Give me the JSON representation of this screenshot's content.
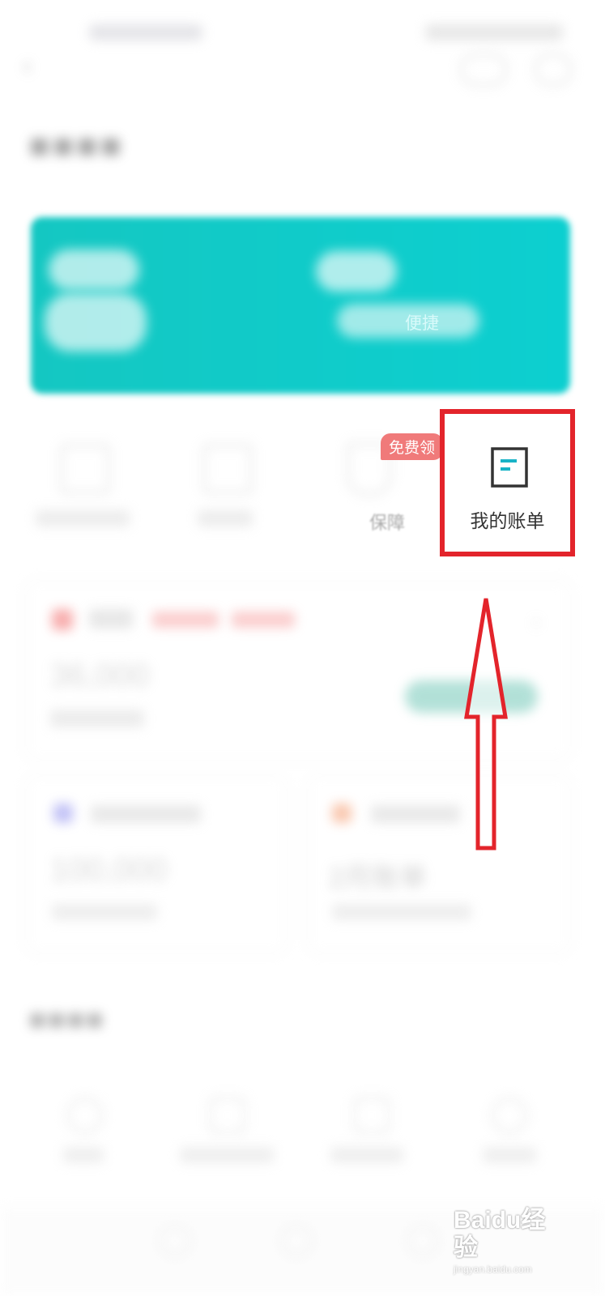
{
  "card": {
    "link_text": "便捷"
  },
  "services": {
    "insurance_label": "保障",
    "badge_text": "免费领",
    "bill_label": "我的账单"
  },
  "loan": {
    "amount": "36,000"
  },
  "credit": {
    "amount": "100,000"
  },
  "bill_card": {
    "value": "2月账单"
  },
  "watermark": {
    "text": "Baidu经验",
    "sub": "jingyan.baidu.com"
  },
  "colors": {
    "teal": "#14c7c2",
    "highlight_red": "#e3242b",
    "badge_pink": "#f07a7a"
  }
}
